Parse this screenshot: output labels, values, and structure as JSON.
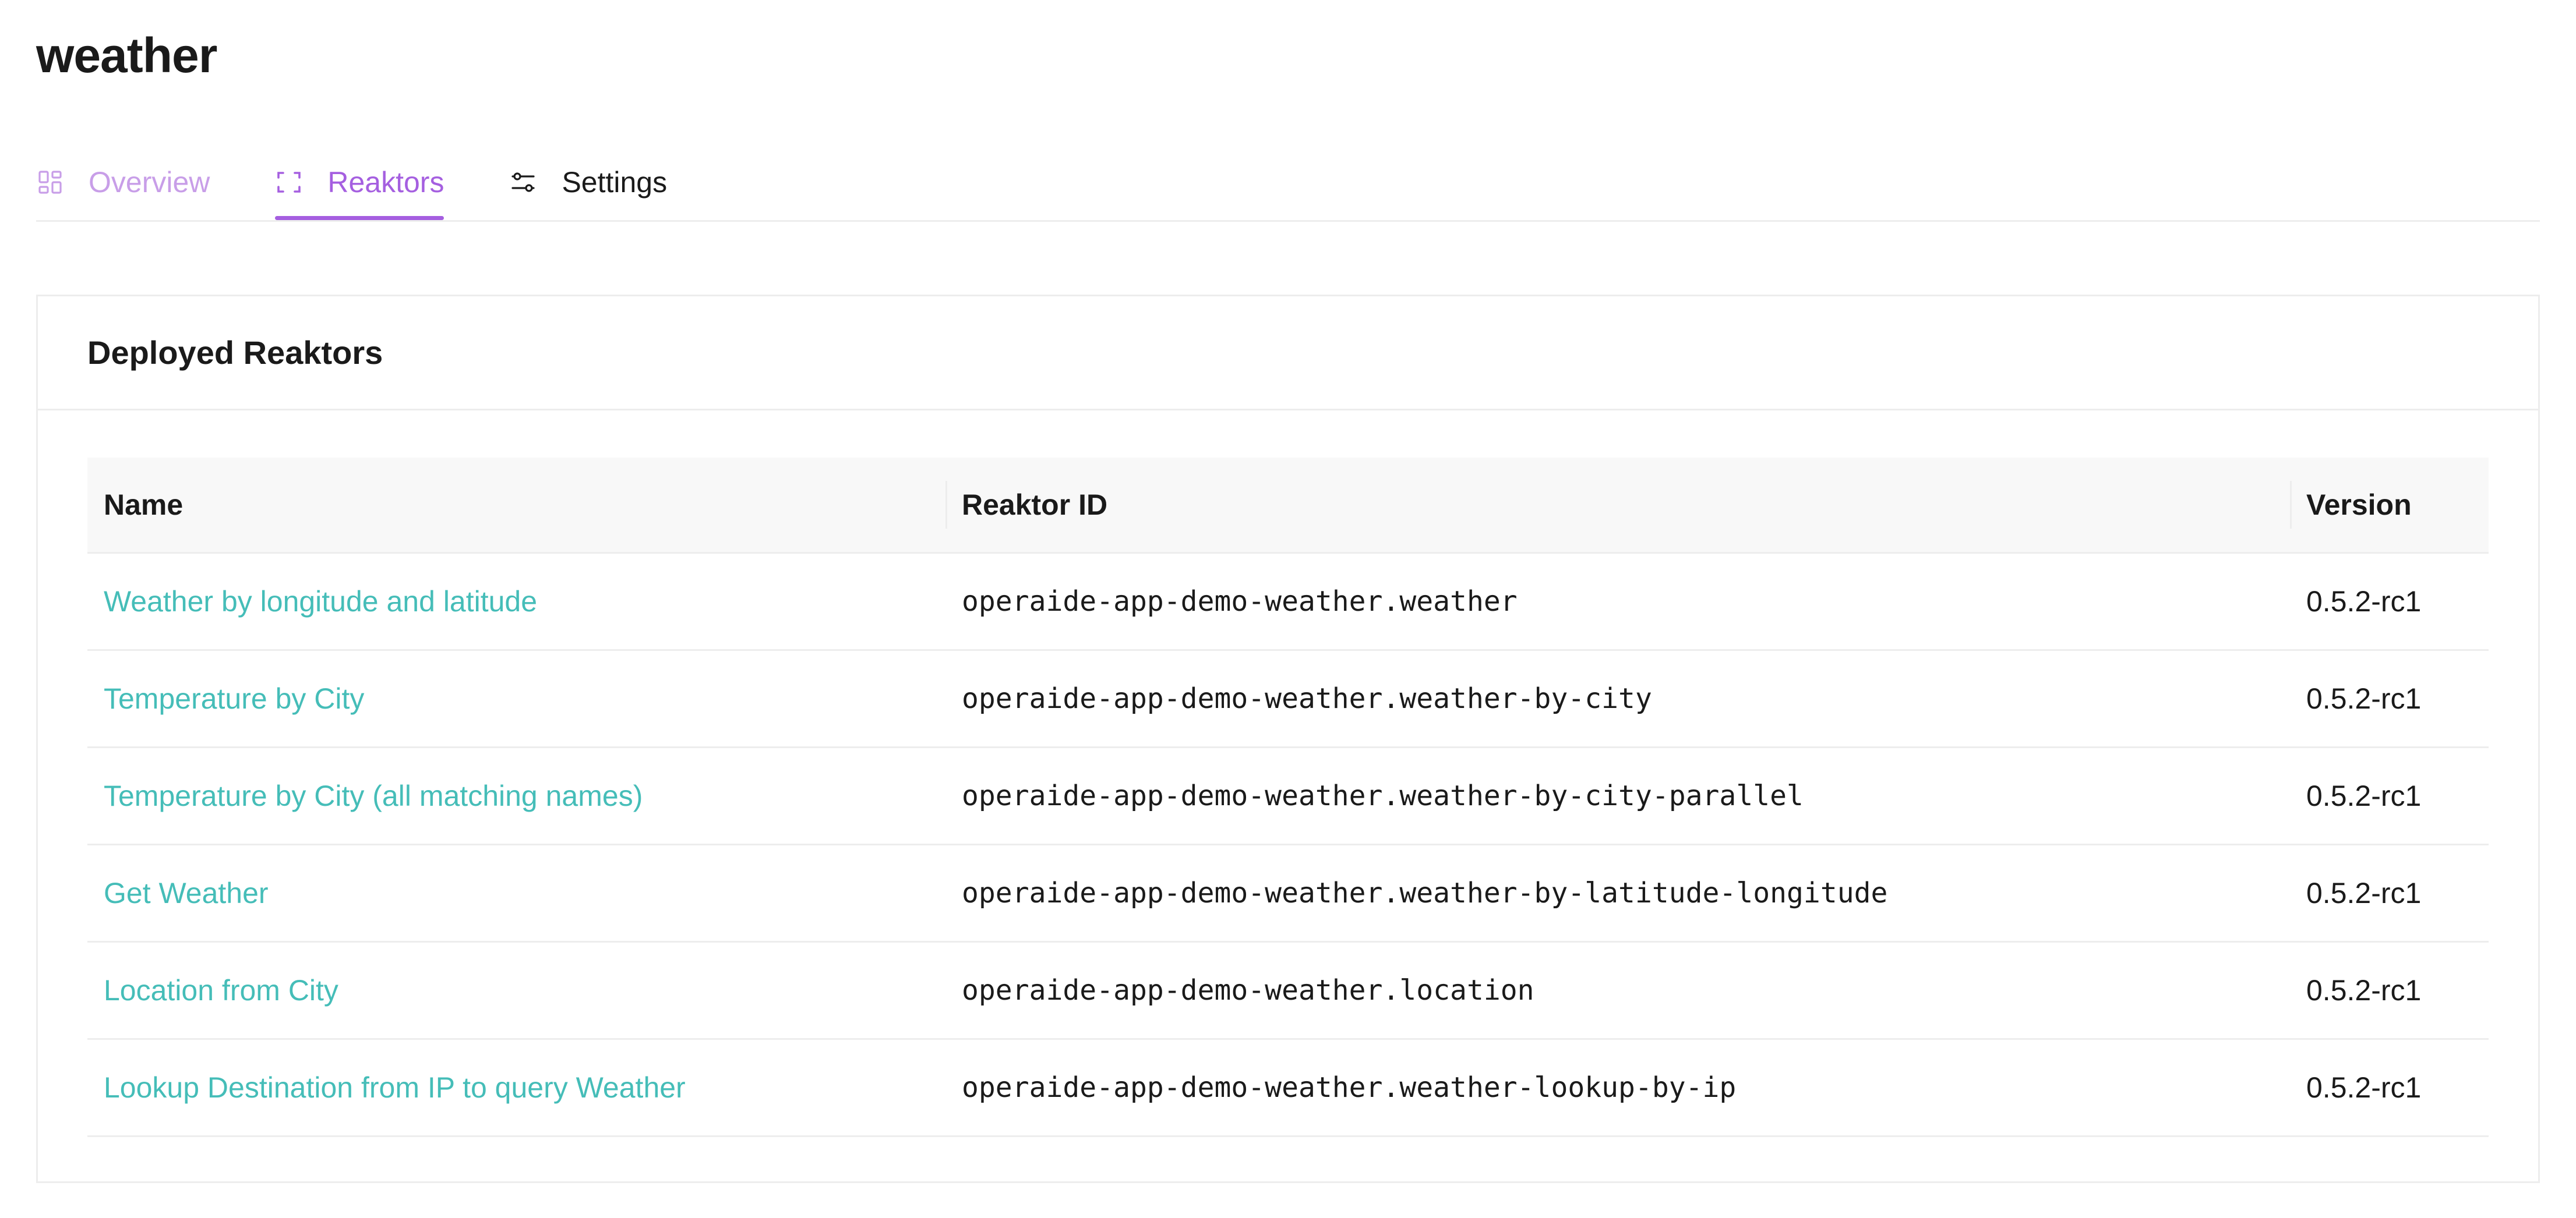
{
  "page": {
    "title": "weather"
  },
  "tabs": [
    {
      "label": "Overview",
      "icon": "dashboard-icon",
      "active": false
    },
    {
      "label": "Reaktors",
      "icon": "focus-frame-icon",
      "active": true
    },
    {
      "label": "Settings",
      "icon": "sliders-icon",
      "active": false
    }
  ],
  "colors": {
    "accent": "#a55fe0",
    "accent_light": "#c89ee8",
    "link": "#45bdb8",
    "border": "#ededed",
    "header_bg": "#f8f8f8"
  },
  "card": {
    "title": "Deployed Reaktors"
  },
  "table": {
    "columns": [
      "Name",
      "Reaktor ID",
      "Version"
    ],
    "rows": [
      {
        "name": "Weather by longitude and latitude",
        "id": "operaide-app-demo-weather.weather",
        "version": "0.5.2-rc1"
      },
      {
        "name": "Temperature by City",
        "id": "operaide-app-demo-weather.weather-by-city",
        "version": "0.5.2-rc1"
      },
      {
        "name": "Temperature by City (all matching names)",
        "id": "operaide-app-demo-weather.weather-by-city-parallel",
        "version": "0.5.2-rc1"
      },
      {
        "name": "Get Weather",
        "id": "operaide-app-demo-weather.weather-by-latitude-longitude",
        "version": "0.5.2-rc1"
      },
      {
        "name": "Location from City",
        "id": "operaide-app-demo-weather.location",
        "version": "0.5.2-rc1"
      },
      {
        "name": "Lookup Destination from IP to query Weather",
        "id": "operaide-app-demo-weather.weather-lookup-by-ip",
        "version": "0.5.2-rc1"
      }
    ]
  }
}
